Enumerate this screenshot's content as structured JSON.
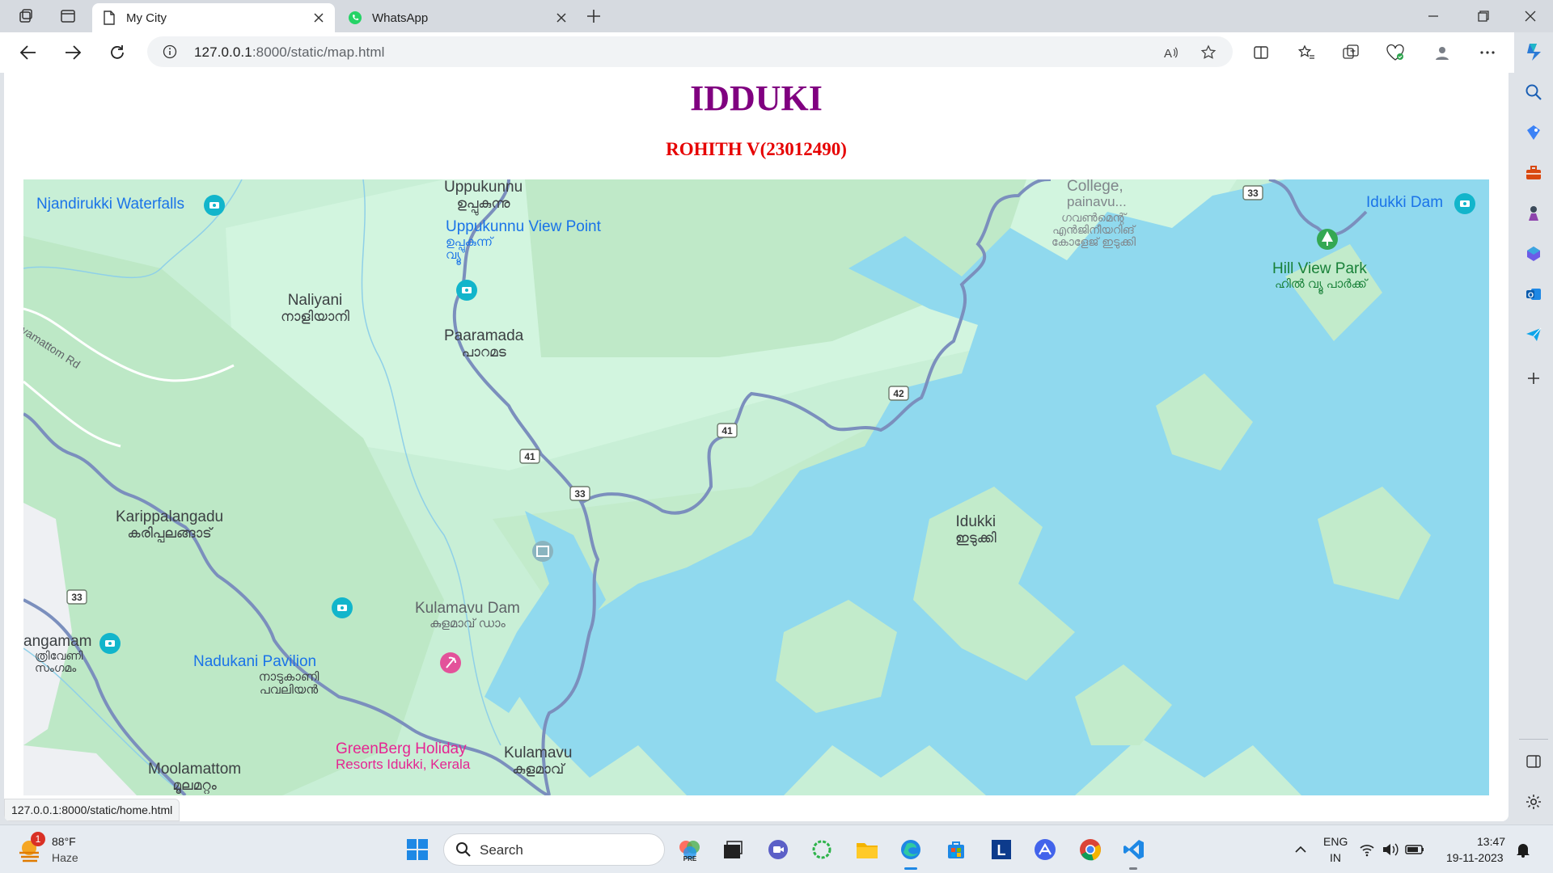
{
  "browser": {
    "tabs": [
      {
        "title": "My City",
        "active": true
      },
      {
        "title": "WhatsApp",
        "active": false
      }
    ],
    "address": {
      "host": "127.0.0.1",
      "path": ":8000/static/map.html"
    },
    "status_url": "127.0.0.1:8000/static/home.html"
  },
  "page": {
    "title": "IDDUKI",
    "subtitle": "ROHITH V(23012490)"
  },
  "map": {
    "places": [
      {
        "name": "Uppukunnu",
        "local": "ഉപ്പുകുന്നു"
      },
      {
        "name": "Naliyani",
        "local": "നാളിയാനി"
      },
      {
        "name": "Paaramada",
        "local": "പാറമട"
      },
      {
        "name": "Karippalangadu",
        "local": "കരിപ്പലങ്ങാട്"
      },
      {
        "name": "Idukki",
        "local": "ഇടുക്കി"
      },
      {
        "name": "Kulamavu",
        "local": "കുളമാവ്"
      },
      {
        "name": "Moolamattom",
        "local": "മൂലമറ്റം"
      },
      {
        "name": "angamam",
        "local": "ത്രിവേണി സംഗമം"
      }
    ],
    "pois": [
      {
        "name": "Njandirukki Waterfalls"
      },
      {
        "name": "Uppukunnu View Point",
        "local": "ഉപ്പുകുന്ന് വ്യൂ"
      },
      {
        "name": "Idukki Dam"
      },
      {
        "name": "Hill View Park",
        "local": "ഹിൽ വ്യൂ പാർക്ക്"
      },
      {
        "name": "Kulamavu Dam",
        "local": "കുളമാവ് ഡാം"
      },
      {
        "name": "Nadukani Pavilion",
        "local": "നാടുകാണി പവലിയൻ"
      },
      {
        "name": "GreenBerg Holiday",
        "local": "Resorts Idukki, Kerala"
      },
      {
        "name": "College,",
        "local": "painavu..."
      }
    ],
    "college_local": "ഗവൺമെന്റ് എൻജിനീയറിങ് കോളേജ് ഇടുക്കി",
    "road_name": "Iyamattom Rd",
    "shields": [
      "33",
      "41",
      "41",
      "33",
      "33",
      "42"
    ],
    "colors": {
      "land": "#c6f0d8",
      "forest": "#bde9c9",
      "water": "#90d9ee",
      "road": "#7b8fbd",
      "urban": "#eef0f3"
    }
  },
  "sidebar": {
    "icons": [
      "copilot-icon",
      "search-icon",
      "shopping-icon",
      "tools-icon",
      "games-icon",
      "m365-icon",
      "outlook-icon",
      "send-icon",
      "add-icon",
      "sidebar-toggle-icon",
      "settings-icon"
    ]
  },
  "taskbar": {
    "weather": {
      "temp": "88°F",
      "condition": "Haze",
      "badge": "1"
    },
    "search_placeholder": "Search",
    "lang": {
      "line1": "ENG",
      "line2": "IN"
    },
    "time": "13:47",
    "date": "19-11-2023"
  }
}
